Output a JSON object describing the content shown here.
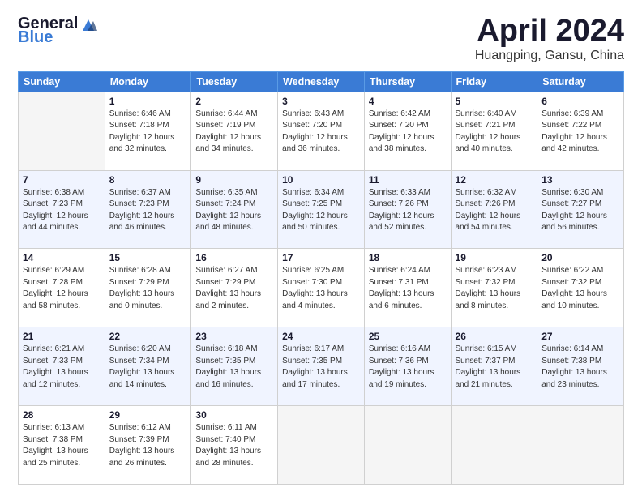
{
  "header": {
    "logo_general": "General",
    "logo_blue": "Blue",
    "title": "April 2024",
    "location": "Huangping, Gansu, China"
  },
  "weekdays": [
    "Sunday",
    "Monday",
    "Tuesday",
    "Wednesday",
    "Thursday",
    "Friday",
    "Saturday"
  ],
  "weeks": [
    [
      {
        "num": "",
        "info": ""
      },
      {
        "num": "1",
        "info": "Sunrise: 6:46 AM\nSunset: 7:18 PM\nDaylight: 12 hours\nand 32 minutes."
      },
      {
        "num": "2",
        "info": "Sunrise: 6:44 AM\nSunset: 7:19 PM\nDaylight: 12 hours\nand 34 minutes."
      },
      {
        "num": "3",
        "info": "Sunrise: 6:43 AM\nSunset: 7:20 PM\nDaylight: 12 hours\nand 36 minutes."
      },
      {
        "num": "4",
        "info": "Sunrise: 6:42 AM\nSunset: 7:20 PM\nDaylight: 12 hours\nand 38 minutes."
      },
      {
        "num": "5",
        "info": "Sunrise: 6:40 AM\nSunset: 7:21 PM\nDaylight: 12 hours\nand 40 minutes."
      },
      {
        "num": "6",
        "info": "Sunrise: 6:39 AM\nSunset: 7:22 PM\nDaylight: 12 hours\nand 42 minutes."
      }
    ],
    [
      {
        "num": "7",
        "info": "Sunrise: 6:38 AM\nSunset: 7:23 PM\nDaylight: 12 hours\nand 44 minutes."
      },
      {
        "num": "8",
        "info": "Sunrise: 6:37 AM\nSunset: 7:23 PM\nDaylight: 12 hours\nand 46 minutes."
      },
      {
        "num": "9",
        "info": "Sunrise: 6:35 AM\nSunset: 7:24 PM\nDaylight: 12 hours\nand 48 minutes."
      },
      {
        "num": "10",
        "info": "Sunrise: 6:34 AM\nSunset: 7:25 PM\nDaylight: 12 hours\nand 50 minutes."
      },
      {
        "num": "11",
        "info": "Sunrise: 6:33 AM\nSunset: 7:26 PM\nDaylight: 12 hours\nand 52 minutes."
      },
      {
        "num": "12",
        "info": "Sunrise: 6:32 AM\nSunset: 7:26 PM\nDaylight: 12 hours\nand 54 minutes."
      },
      {
        "num": "13",
        "info": "Sunrise: 6:30 AM\nSunset: 7:27 PM\nDaylight: 12 hours\nand 56 minutes."
      }
    ],
    [
      {
        "num": "14",
        "info": "Sunrise: 6:29 AM\nSunset: 7:28 PM\nDaylight: 12 hours\nand 58 minutes."
      },
      {
        "num": "15",
        "info": "Sunrise: 6:28 AM\nSunset: 7:29 PM\nDaylight: 13 hours\nand 0 minutes."
      },
      {
        "num": "16",
        "info": "Sunrise: 6:27 AM\nSunset: 7:29 PM\nDaylight: 13 hours\nand 2 minutes."
      },
      {
        "num": "17",
        "info": "Sunrise: 6:25 AM\nSunset: 7:30 PM\nDaylight: 13 hours\nand 4 minutes."
      },
      {
        "num": "18",
        "info": "Sunrise: 6:24 AM\nSunset: 7:31 PM\nDaylight: 13 hours\nand 6 minutes."
      },
      {
        "num": "19",
        "info": "Sunrise: 6:23 AM\nSunset: 7:32 PM\nDaylight: 13 hours\nand 8 minutes."
      },
      {
        "num": "20",
        "info": "Sunrise: 6:22 AM\nSunset: 7:32 PM\nDaylight: 13 hours\nand 10 minutes."
      }
    ],
    [
      {
        "num": "21",
        "info": "Sunrise: 6:21 AM\nSunset: 7:33 PM\nDaylight: 13 hours\nand 12 minutes."
      },
      {
        "num": "22",
        "info": "Sunrise: 6:20 AM\nSunset: 7:34 PM\nDaylight: 13 hours\nand 14 minutes."
      },
      {
        "num": "23",
        "info": "Sunrise: 6:18 AM\nSunset: 7:35 PM\nDaylight: 13 hours\nand 16 minutes."
      },
      {
        "num": "24",
        "info": "Sunrise: 6:17 AM\nSunset: 7:35 PM\nDaylight: 13 hours\nand 17 minutes."
      },
      {
        "num": "25",
        "info": "Sunrise: 6:16 AM\nSunset: 7:36 PM\nDaylight: 13 hours\nand 19 minutes."
      },
      {
        "num": "26",
        "info": "Sunrise: 6:15 AM\nSunset: 7:37 PM\nDaylight: 13 hours\nand 21 minutes."
      },
      {
        "num": "27",
        "info": "Sunrise: 6:14 AM\nSunset: 7:38 PM\nDaylight: 13 hours\nand 23 minutes."
      }
    ],
    [
      {
        "num": "28",
        "info": "Sunrise: 6:13 AM\nSunset: 7:38 PM\nDaylight: 13 hours\nand 25 minutes."
      },
      {
        "num": "29",
        "info": "Sunrise: 6:12 AM\nSunset: 7:39 PM\nDaylight: 13 hours\nand 26 minutes."
      },
      {
        "num": "30",
        "info": "Sunrise: 6:11 AM\nSunset: 7:40 PM\nDaylight: 13 hours\nand 28 minutes."
      },
      {
        "num": "",
        "info": ""
      },
      {
        "num": "",
        "info": ""
      },
      {
        "num": "",
        "info": ""
      },
      {
        "num": "",
        "info": ""
      }
    ]
  ]
}
